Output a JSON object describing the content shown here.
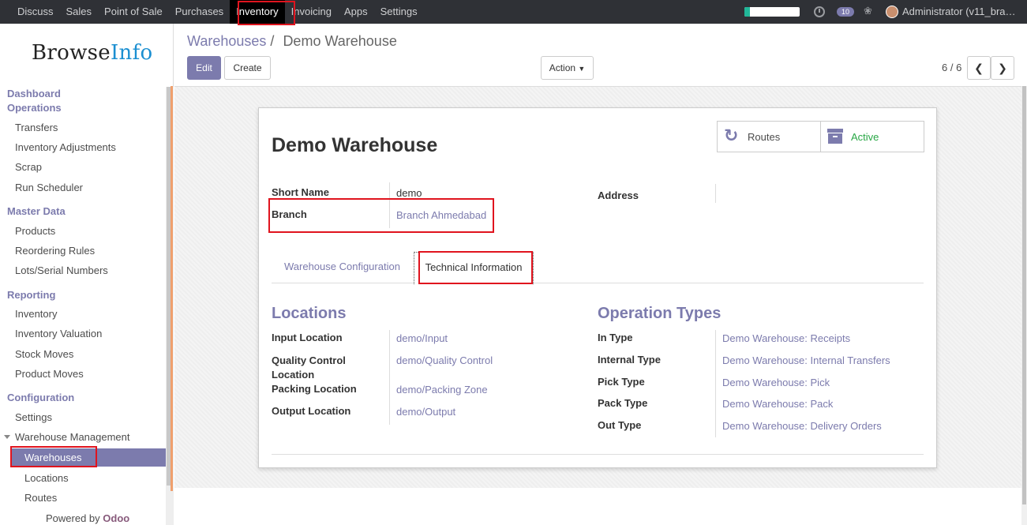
{
  "topbar": {
    "menu": [
      "Discuss",
      "Sales",
      "Point of Sale",
      "Purchases",
      "Inventory",
      "Invoicing",
      "Apps",
      "Settings"
    ],
    "active_menu": "Inventory",
    "chat_count": "10",
    "user": "Administrator (v11_bra…",
    "progress_fraction": 0.1
  },
  "sidebar": {
    "logo_browse": "Browse",
    "logo_info": "Info",
    "sections": {
      "dashboard": "Dashboard",
      "operations": "Operations",
      "master_data": "Master Data",
      "reporting": "Reporting",
      "configuration": "Configuration"
    },
    "operations": [
      "Transfers",
      "Inventory Adjustments",
      "Scrap",
      "Run Scheduler"
    ],
    "master_data": [
      "Products",
      "Reordering Rules",
      "Lots/Serial Numbers"
    ],
    "reporting": [
      "Inventory",
      "Inventory Valuation",
      "Stock Moves",
      "Product Moves"
    ],
    "configuration": [
      "Settings",
      "Warehouse Management"
    ],
    "warehouse_mgmt": [
      "Warehouses",
      "Locations",
      "Routes"
    ],
    "powered_by": "Powered by",
    "powered_brand": "Odoo"
  },
  "control": {
    "breadcrumb_parent": "Warehouses",
    "breadcrumb_sep": "/",
    "breadcrumb_current": "Demo Warehouse",
    "edit": "Edit",
    "create": "Create",
    "action": "Action",
    "pager": "6 / 6"
  },
  "form": {
    "title": "Demo Warehouse",
    "stat_routes": "Routes",
    "stat_active": "Active",
    "short_name_label": "Short Name",
    "short_name": "demo",
    "branch_label": "Branch",
    "branch": "Branch Ahmedabad",
    "address_label": "Address",
    "tabs": [
      "Warehouse Configuration",
      "Technical Information"
    ],
    "locations_title": "Locations",
    "locations": [
      {
        "label": "Input Location",
        "value": "demo/Input"
      },
      {
        "label": "Quality Control Location",
        "value": "demo/Quality Control"
      },
      {
        "label": "Packing Location",
        "value": "demo/Packing Zone"
      },
      {
        "label": "Output Location",
        "value": "demo/Output"
      }
    ],
    "operation_types_title": "Operation Types",
    "operation_types": [
      {
        "label": "In Type",
        "value": "Demo Warehouse: Receipts"
      },
      {
        "label": "Internal Type",
        "value": "Demo Warehouse: Internal Transfers"
      },
      {
        "label": "Pick Type",
        "value": "Demo Warehouse: Pick"
      },
      {
        "label": "Pack Type",
        "value": "Demo Warehouse: Pack"
      },
      {
        "label": "Out Type",
        "value": "Demo Warehouse: Delivery Orders"
      }
    ]
  },
  "colors": {
    "primary": "#7c7bad",
    "topbar": "#2f3136",
    "highlight": "#e0141e",
    "active_status": "#28a745"
  }
}
